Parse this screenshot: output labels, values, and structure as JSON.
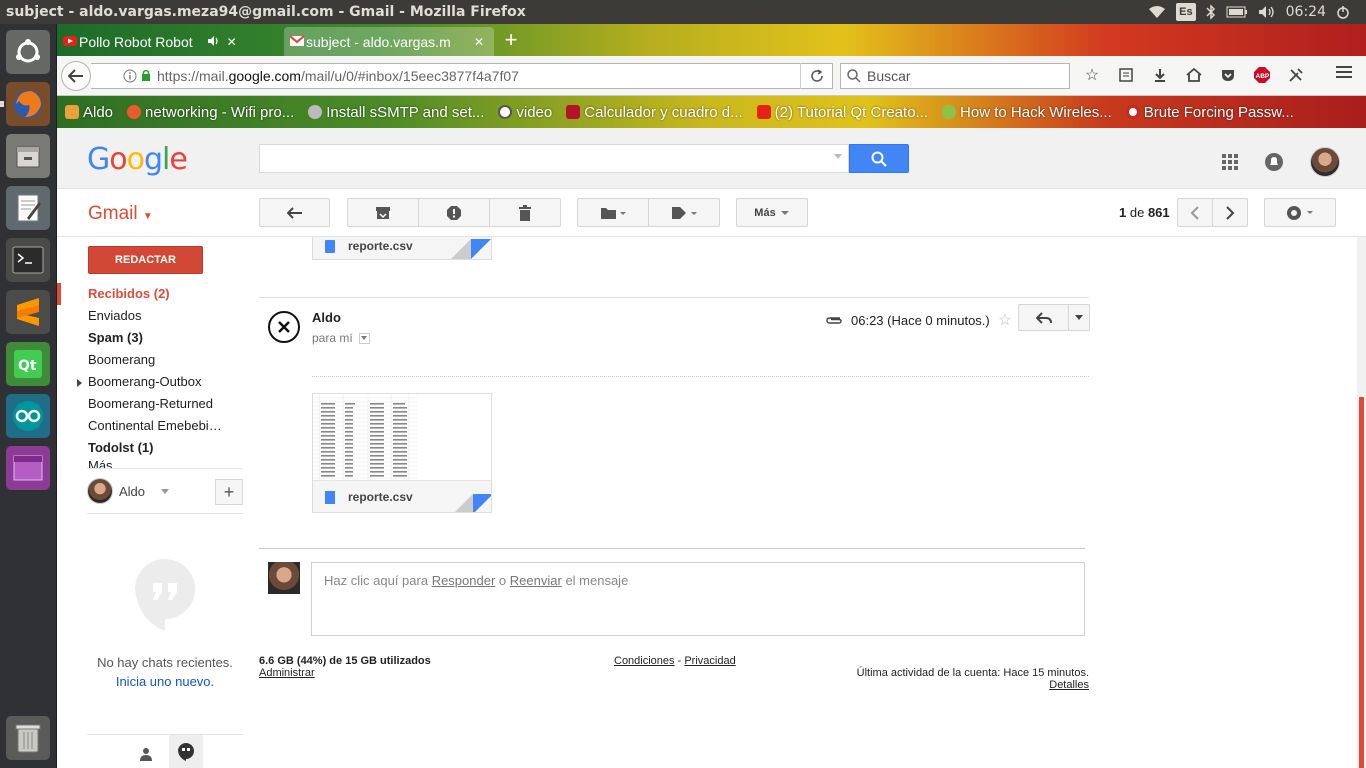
{
  "window": {
    "title": "subject - aldo.vargas.meza94@gmail.com - Gmail - Mozilla Firefox"
  },
  "system": {
    "keyboard": "Es",
    "clock": "06:24"
  },
  "launcher": {
    "items": [
      "ubuntu-dash-icon",
      "firefox-icon",
      "files-icon",
      "text-editor-icon",
      "terminal-icon",
      "sublime-text-icon",
      "qt-creator-icon",
      "arduino-icon",
      "workspace-switcher-icon",
      "trash-icon"
    ]
  },
  "tabs": [
    {
      "label": "Pollo Robot Robot",
      "favicon": "youtube-icon",
      "audio": true
    },
    {
      "label": "subject - aldo.vargas.m",
      "favicon": "gmail-icon",
      "active": true
    }
  ],
  "url": {
    "scheme": "https://mail.",
    "host": "google.com",
    "path": "/mail/u/0/#inbox/15eec3877f4a7f07"
  },
  "search": {
    "placeholder": "Buscar"
  },
  "bookmarks": [
    {
      "label": "Aldo",
      "icon": "folder-icon"
    },
    {
      "label": "networking - Wifi pro...",
      "icon": "ask-icon"
    },
    {
      "label": "Install sSMTP and set...",
      "icon": "gear-icon"
    },
    {
      "label": "video",
      "icon": "globe-icon"
    },
    {
      "label": "Calculador y cuadro d...",
      "icon": "video-icon"
    },
    {
      "label": "(2) Tutorial Qt Creato...",
      "icon": "youtube-icon"
    },
    {
      "label": "How to Hack Wireles...",
      "icon": "android-icon"
    },
    {
      "label": "Brute Forcing Passw...",
      "icon": "target-icon"
    }
  ],
  "gmail": {
    "logo": "Google",
    "app_label": "Gmail",
    "toolbar": {
      "more_label": "Más",
      "page_current": "1",
      "page_of": "de",
      "page_total": "861"
    },
    "compose_label": "REDACTAR",
    "nav": [
      {
        "label": "Recibidos (2)",
        "state": "active"
      },
      {
        "label": "Enviados",
        "state": ""
      },
      {
        "label": "Spam (3)",
        "state": "bold"
      },
      {
        "label": "Boomerang",
        "state": ""
      },
      {
        "label": "Boomerang-Outbox",
        "state": "expandable"
      },
      {
        "label": "Boomerang-Returned",
        "state": ""
      },
      {
        "label": "Continental Emebebi…",
        "state": ""
      },
      {
        "label": "Todolst (1)",
        "state": "bold"
      },
      {
        "label": "Más",
        "state": "partial"
      }
    ],
    "chat": {
      "user": "Aldo",
      "no_chats": "No hay chats recientes.",
      "start_new": "Inicia uno nuevo."
    },
    "thread": {
      "prev_attachment": "reporte.csv",
      "sender": "Aldo",
      "to": "para mí",
      "time": "06:23 (Hace 0 minutos.)",
      "attachment": "reporte.csv",
      "reply_prompt_pre": "Haz clic aquí para",
      "reply_link": "Responder",
      "reply_or": "o",
      "forward_link": "Reenviar",
      "reply_prompt_post": "el mensaje"
    },
    "footer": {
      "quota": "6.6 GB (44%) de 15 GB utilizados",
      "manage": "Administrar",
      "terms": "Condiciones",
      "sep": "-",
      "privacy": "Privacidad",
      "activity": "Última actividad de la cuenta: Hace 15 minutos.",
      "details": "Detalles"
    }
  }
}
